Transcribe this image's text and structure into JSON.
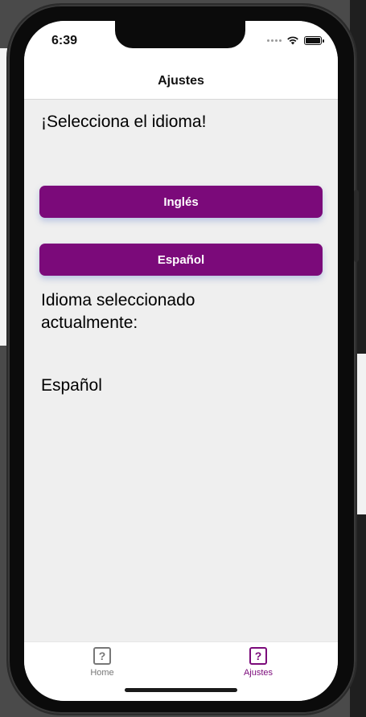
{
  "status_bar": {
    "time": "6:39"
  },
  "header": {
    "title": "Ajustes"
  },
  "main": {
    "heading": "¡Selecciona el idioma!",
    "buttons": [
      {
        "label": "Inglés"
      },
      {
        "label": "Español"
      }
    ],
    "current_label": "Idioma seleccionado actualmente:",
    "current_value": "Español"
  },
  "tab_bar": {
    "tabs": [
      {
        "label": "Home",
        "icon": "question-box-icon",
        "active": false
      },
      {
        "label": "Ajustes",
        "icon": "question-box-icon",
        "active": true
      }
    ]
  },
  "colors": {
    "accent": "#7b0a7a",
    "background": "#efefef",
    "inactive_tab": "#777777"
  }
}
